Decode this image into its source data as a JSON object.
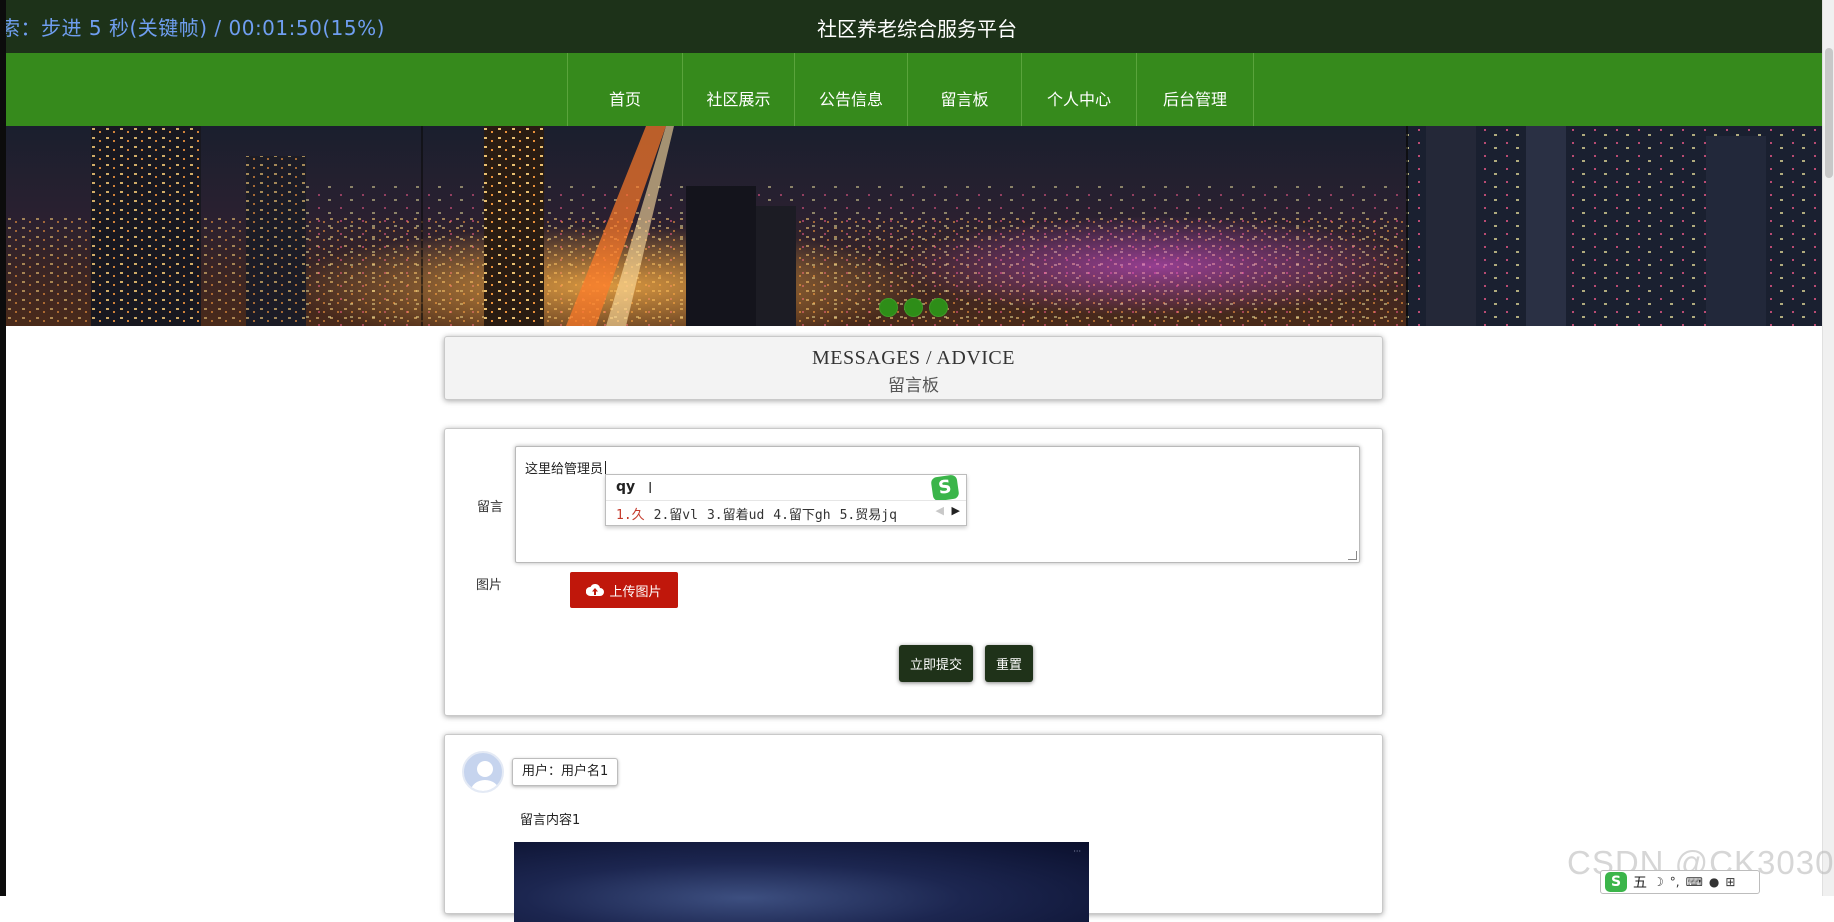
{
  "overlay": {
    "text": "索：步进 5 秒(关键帧) / 00:01:50(15%)"
  },
  "site": {
    "title": "社区养老综合服务平台"
  },
  "nav": {
    "items": [
      "首页",
      "社区展示",
      "公告信息",
      "留言板",
      "个人中心",
      "后台管理"
    ]
  },
  "banner": {
    "dot_count": 3,
    "accent_color": "#2e8d18"
  },
  "section": {
    "title_en": "MESSAGES / ADVICE",
    "title_cn": "留言板"
  },
  "form": {
    "message_label": "留言",
    "message_value": "这里给管理员",
    "image_label": "图片",
    "upload_button": "上传图片",
    "submit_button": "立即提交",
    "reset_button": "重置"
  },
  "ime": {
    "input": "qy",
    "candidates": [
      "1.久",
      "2.留vl",
      "3.留着ud",
      "4.留下gh",
      "5.贸易jq"
    ],
    "logo": "S",
    "status_mode": "五"
  },
  "message": {
    "user": "用户：用户名1",
    "content": "留言内容1"
  },
  "watermark": "CSDN @CK3030",
  "colors": {
    "topbar": "#1d3219",
    "navbar": "#368a1c",
    "upload": "#c0170b",
    "buttons": "#1f3219"
  }
}
